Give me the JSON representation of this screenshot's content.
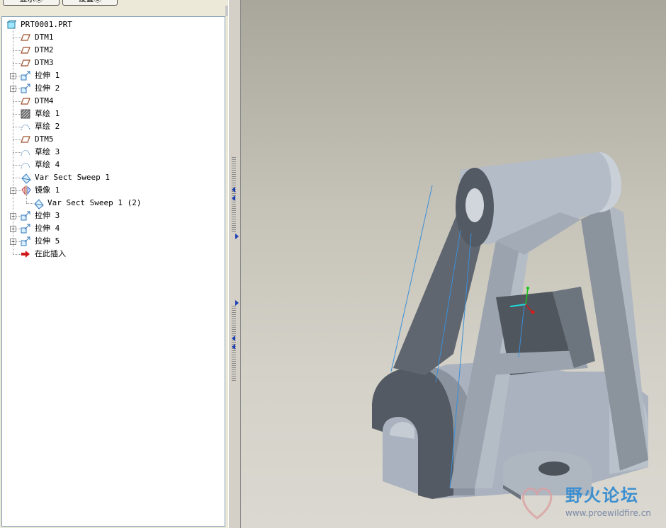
{
  "toolbar": {
    "show_label": "显示Ⓒ",
    "settings_label": "设置Ⓢ"
  },
  "tree": {
    "items": [
      {
        "label": "PRT0001.PRT",
        "icon": "part-icon"
      },
      {
        "label": "DTM1",
        "icon": "datum-plane-icon"
      },
      {
        "label": "DTM2",
        "icon": "datum-plane-icon"
      },
      {
        "label": "DTM3",
        "icon": "datum-plane-icon"
      },
      {
        "label": "拉伸 1",
        "icon": "extrude-icon",
        "expandable": true
      },
      {
        "label": "拉伸 2",
        "icon": "extrude-icon",
        "expandable": true
      },
      {
        "label": "DTM4",
        "icon": "datum-plane-icon"
      },
      {
        "label": "草绘 1",
        "icon": "sketch-hatched-icon"
      },
      {
        "label": "草绘 2",
        "icon": "sketch-icon"
      },
      {
        "label": "DTM5",
        "icon": "datum-plane-icon"
      },
      {
        "label": "草绘 3",
        "icon": "sketch-icon"
      },
      {
        "label": "草绘 4",
        "icon": "sketch-icon"
      },
      {
        "label": "Var Sect Sweep 1",
        "icon": "sweep-icon"
      },
      {
        "label": "镜像 1",
        "icon": "mirror-icon",
        "expandable": true,
        "expanded": true
      },
      {
        "label": "Var Sect Sweep 1 (2)",
        "icon": "sweep-icon",
        "child": true
      },
      {
        "label": "拉伸 3",
        "icon": "extrude-icon",
        "expandable": true
      },
      {
        "label": "拉伸 4",
        "icon": "extrude-icon",
        "expandable": true
      },
      {
        "label": "拉伸 5",
        "icon": "extrude-icon",
        "expandable": true
      },
      {
        "label": "在此插入",
        "icon": "insert-here-arrow-icon"
      }
    ]
  },
  "watermark": {
    "title": "野火论坛",
    "url": "www.proewildfire.cn"
  },
  "colors": {
    "model_face": "#aab3bf",
    "model_shadow": "#5b626b",
    "datum_curve": "#3a8fd9",
    "watermark_title": "#3e8fcf"
  }
}
